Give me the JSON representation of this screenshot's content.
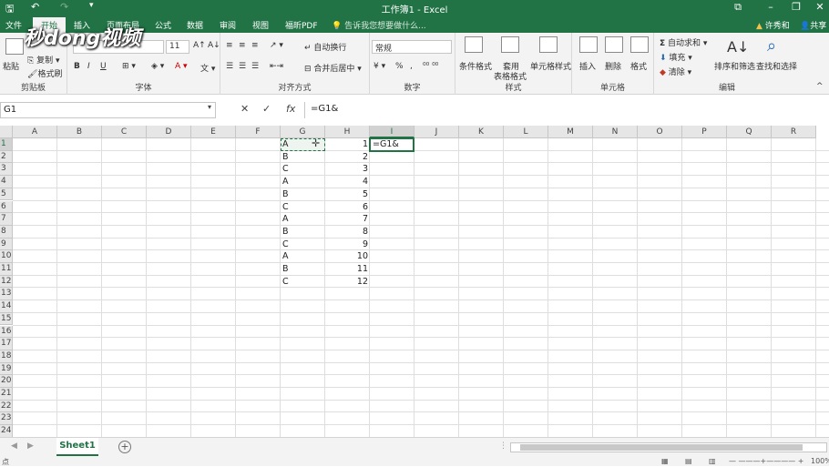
{
  "window": {
    "title": "工作簿1 - Excel"
  },
  "menu": {
    "items": [
      "文件",
      "开始",
      "插入",
      "页面布局",
      "公式",
      "数据",
      "审阅",
      "视图",
      "福昕PDF"
    ],
    "tell_me": "告诉我您想要做什么...",
    "user": "许秀和",
    "share": "共享"
  },
  "watermark": "秒dong视频",
  "ribbon": {
    "clipboard": {
      "label": "剪贴板",
      "paste": "粘贴",
      "copy": "复制",
      "format_painter": "格式刷"
    },
    "font": {
      "label": "字体",
      "size": "11",
      "bold": "B",
      "italic": "I",
      "underline": "U"
    },
    "alignment": {
      "label": "对齐方式",
      "wrap": "自动换行",
      "merge": "合并后居中"
    },
    "number": {
      "label": "数字",
      "format": "常规",
      "percent": "%",
      "comma": ","
    },
    "styles": {
      "label": "样式",
      "conditional": "条件格式",
      "table": "套用",
      "table2": "表格格式",
      "cell_styles": "单元格样式"
    },
    "cells": {
      "label": "单元格",
      "insert": "插入",
      "delete": "删除",
      "format": "格式"
    },
    "editing": {
      "label": "编辑",
      "autosum": "自动求和",
      "fill": "填充",
      "clear": "清除",
      "sort": "排序和筛选",
      "find": "查找和选择"
    }
  },
  "formula_bar": {
    "name_box": "G1",
    "cancel": "✕",
    "enter": "✓",
    "fx": "fx",
    "formula": "=G1&"
  },
  "columns": [
    "A",
    "B",
    "C",
    "D",
    "E",
    "F",
    "G",
    "H",
    "I",
    "J",
    "K",
    "L",
    "M",
    "N",
    "O",
    "P",
    "Q",
    "R"
  ],
  "rows": [
    "1",
    "2",
    "3",
    "4",
    "5",
    "6",
    "7",
    "8",
    "9",
    "10",
    "11",
    "12",
    "13",
    "14",
    "15",
    "16",
    "17",
    "18",
    "19",
    "20",
    "21",
    "22",
    "23",
    "24"
  ],
  "cells": {
    "G": [
      "A",
      "B",
      "C",
      "A",
      "B",
      "C",
      "A",
      "B",
      "C",
      "A",
      "B",
      "C"
    ],
    "H": [
      "1",
      "2",
      "3",
      "4",
      "5",
      "6",
      "7",
      "8",
      "9",
      "10",
      "11",
      "12"
    ],
    "I1": "=G1&"
  },
  "sheet": {
    "name": "Sheet1",
    "add": "+"
  },
  "status": {
    "left": "点",
    "zoom": "100%"
  },
  "colors": {
    "accent": "#217346"
  }
}
